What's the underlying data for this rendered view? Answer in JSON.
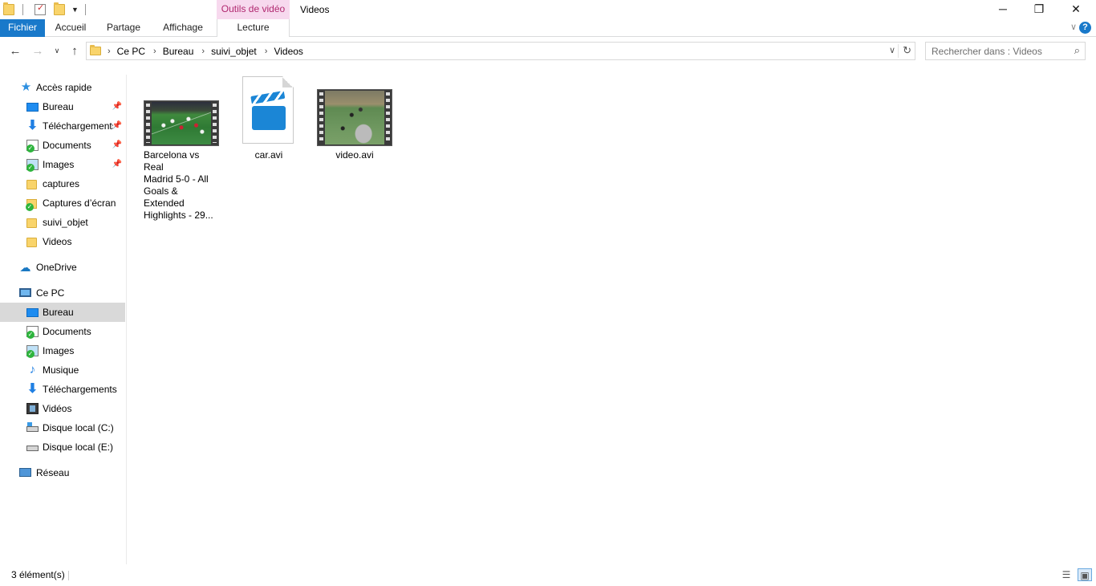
{
  "window": {
    "title": "Videos",
    "contextual_tab_header": "Outils de vidéo",
    "minimize": "─",
    "restore": "❐",
    "close": "✕"
  },
  "ribbon": {
    "tabs": [
      {
        "label": "Fichier"
      },
      {
        "label": "Accueil"
      },
      {
        "label": "Partage"
      },
      {
        "label": "Affichage"
      },
      {
        "label": "Lecture"
      }
    ],
    "help_label": "?"
  },
  "address": {
    "breadcrumbs": [
      "Ce PC",
      "Bureau",
      "suivi_objet",
      "Videos"
    ]
  },
  "search": {
    "placeholder": "Rechercher dans : Videos"
  },
  "nav_pane": {
    "quick_access": {
      "label": "Accès rapide",
      "items": [
        {
          "label": "Bureau",
          "icon": "desktop-icon",
          "pinned": true
        },
        {
          "label": "Téléchargements",
          "icon": "download-icon",
          "pinned": true
        },
        {
          "label": "Documents",
          "icon": "documents-icon",
          "pinned": true
        },
        {
          "label": "Images",
          "icon": "pictures-icon",
          "pinned": true
        },
        {
          "label": "captures",
          "icon": "folder-icon",
          "pinned": false
        },
        {
          "label": "Captures d’écran",
          "icon": "folder-icon",
          "pinned": false
        },
        {
          "label": "suivi_objet",
          "icon": "folder-icon",
          "pinned": false
        },
        {
          "label": "Videos",
          "icon": "folder-icon",
          "pinned": false
        }
      ]
    },
    "onedrive": {
      "label": "OneDrive"
    },
    "this_pc": {
      "label": "Ce PC",
      "items": [
        {
          "label": "Bureau",
          "icon": "desktop-icon",
          "selected": true
        },
        {
          "label": "Documents",
          "icon": "documents-icon"
        },
        {
          "label": "Images",
          "icon": "pictures-icon"
        },
        {
          "label": "Musique",
          "icon": "music-icon"
        },
        {
          "label": "Téléchargements",
          "icon": "download-icon"
        },
        {
          "label": "Vidéos",
          "icon": "videos-icon"
        },
        {
          "label": "Disque local (C:)",
          "icon": "drive-c-icon"
        },
        {
          "label": "Disque local (E:)",
          "icon": "drive-icon"
        }
      ]
    },
    "network": {
      "label": "Réseau"
    }
  },
  "files": [
    {
      "name_lines": [
        "Barcelona vs Real",
        "Madrid 5-0 - All",
        "Goals & Extended",
        "Highlights - 29..."
      ],
      "kind": "video-thumbnail-soccer-night"
    },
    {
      "name_lines": [
        "car.avi"
      ],
      "kind": "generic-video-file"
    },
    {
      "name_lines": [
        "video.avi"
      ],
      "kind": "video-thumbnail-soccer-day"
    }
  ],
  "status_bar": {
    "item_count": "3 élément(s)"
  },
  "colors": {
    "accent": "#1979ca",
    "contextual_tab_bg": "#f7d9ee",
    "contextual_tab_text": "#b0286f",
    "selection": "#d9d9d9"
  }
}
